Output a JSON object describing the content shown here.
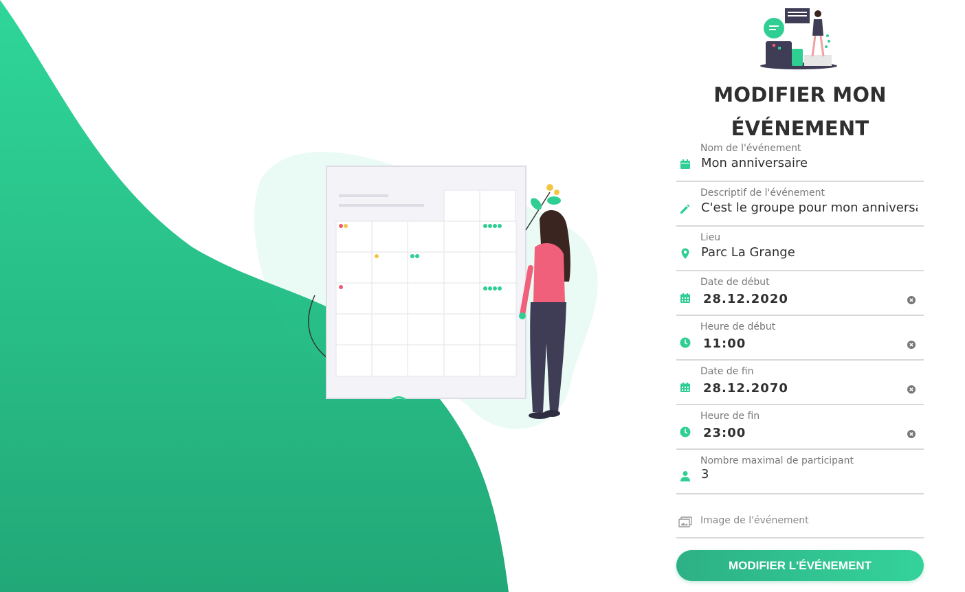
{
  "colors": {
    "accent": "#2fcf94",
    "accent_dark": "#25a77b",
    "icon_grey": "#888888"
  },
  "page": {
    "title": "MODIFIER MON ÉVÉNEMENT"
  },
  "form": {
    "event_name": {
      "label": "Nom de l'événement",
      "value": "Mon anniversaire",
      "icon": "calendar-icon"
    },
    "description": {
      "label": "Descriptif de l'événement",
      "value": "C'est le groupe pour mon anniversaire",
      "icon": "pencil-icon"
    },
    "location": {
      "label": "Lieu",
      "value": "Parc La Grange",
      "icon": "location-pin-icon"
    },
    "start_date": {
      "label": "Date de début",
      "value": "28.12.2020",
      "icon": "calendar-grid-icon"
    },
    "start_time": {
      "label": "Heure de début",
      "value": "11:00",
      "icon": "clock-icon"
    },
    "end_date": {
      "label": "Date de fin",
      "value": "28.12.2070",
      "icon": "calendar-grid-icon"
    },
    "end_time": {
      "label": "Heure de fin",
      "value": "23:00",
      "icon": "clock-icon"
    },
    "max_participants": {
      "label": "Nombre maximal de participant",
      "value": "3",
      "icon": "person-icon"
    },
    "image": {
      "label": "Image de l'événement",
      "icon": "image-icon"
    },
    "submit_label": "MODIFIER L'ÉVÉNEMENT"
  }
}
